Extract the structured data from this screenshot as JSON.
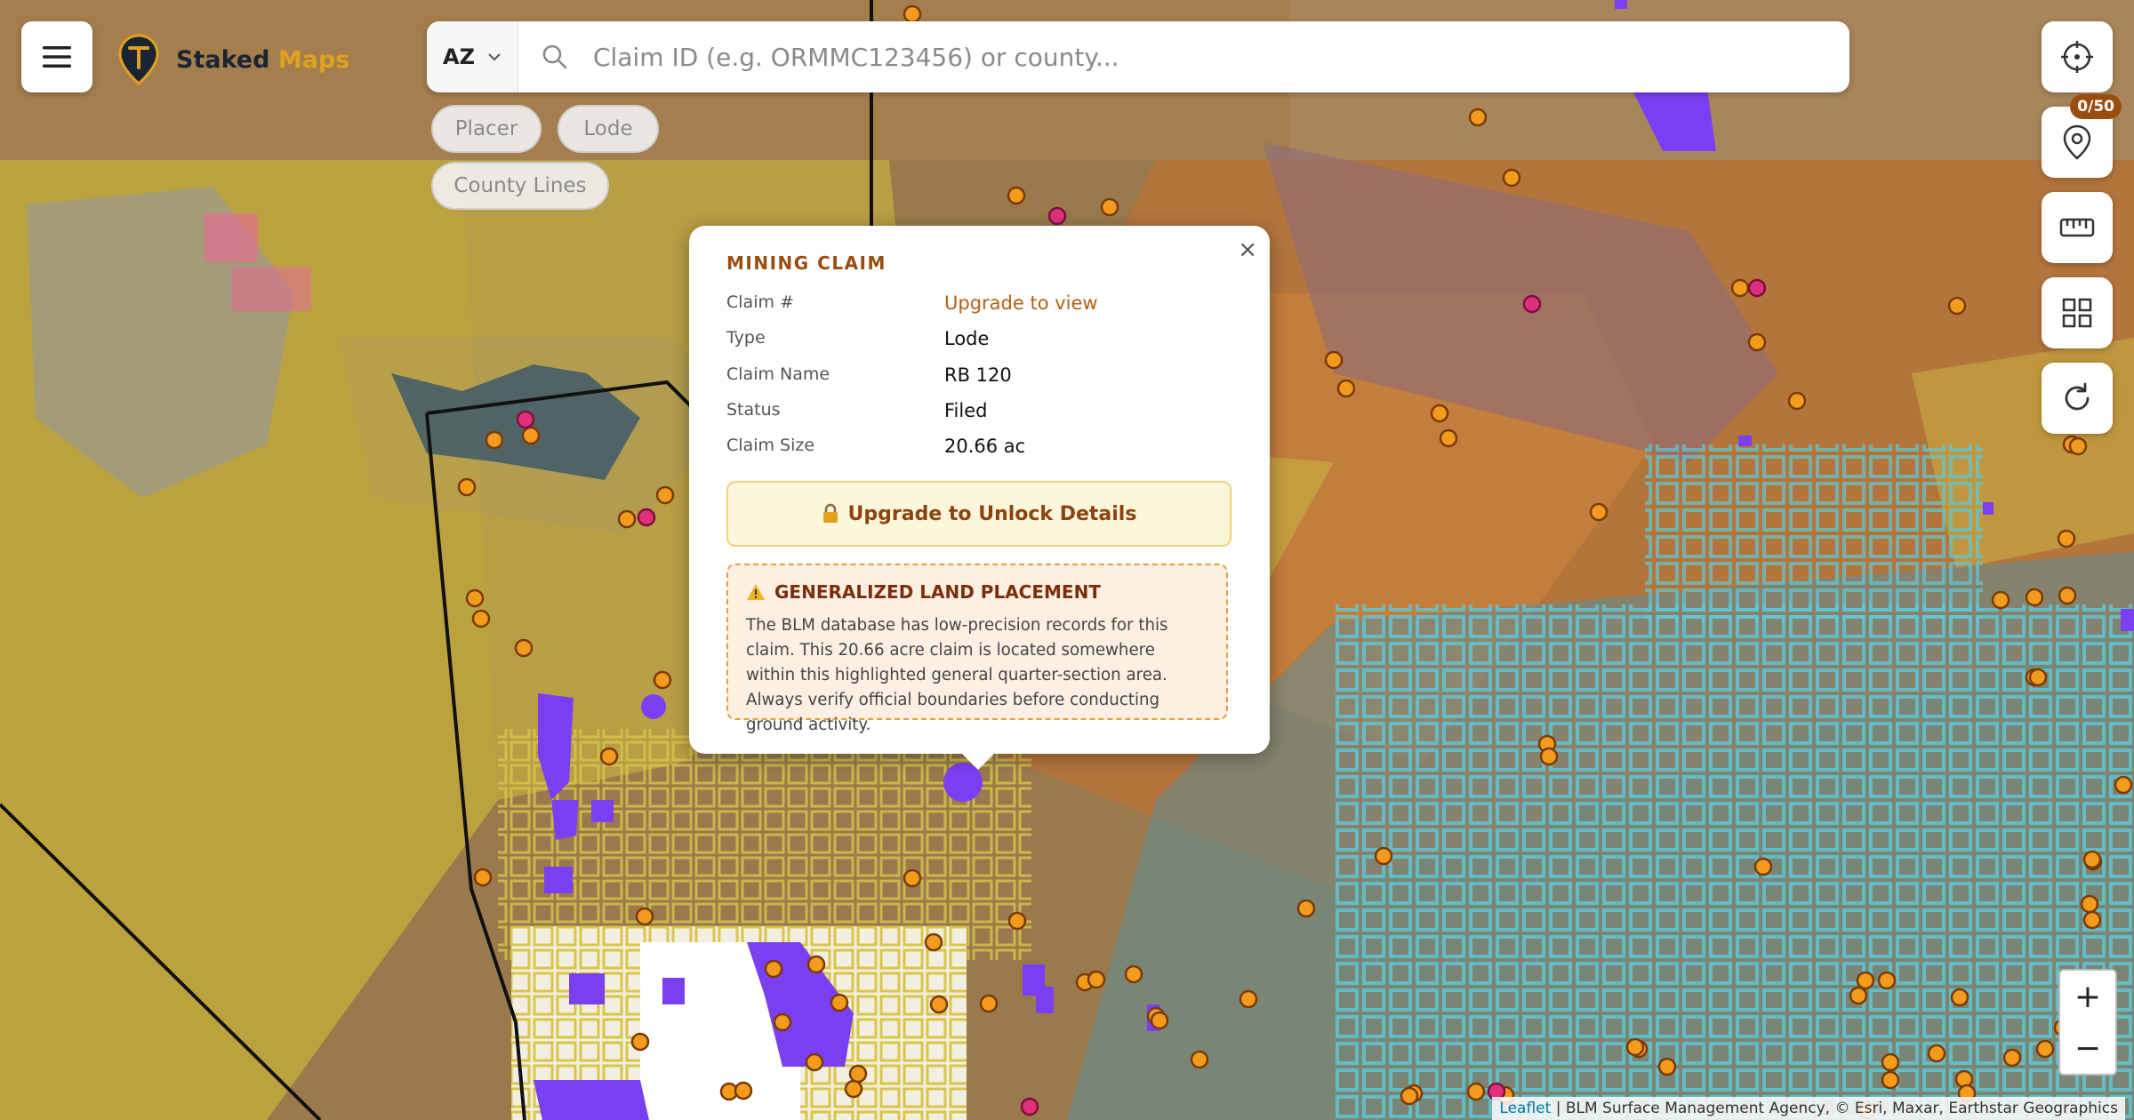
{
  "app": {
    "brand_part1": "Staked",
    "brand_part2": "Maps"
  },
  "search": {
    "state": "AZ",
    "placeholder": "Claim ID (e.g. ORMMC123456) or county..."
  },
  "filters": [
    "Placer",
    "Lode",
    "County Lines"
  ],
  "toolbar": {
    "locate_icon": "crosshair-icon",
    "saved_icon": "map-pin-icon",
    "saved_count": "0/50",
    "measure_icon": "ruler-icon",
    "layers_icon": "grid-icon",
    "refresh_icon": "refresh-icon"
  },
  "popup": {
    "title": "MINING CLAIM",
    "close": "×",
    "rows": [
      {
        "label": "Claim #",
        "value": "Upgrade to view"
      },
      {
        "label": "Type",
        "value": "Lode"
      },
      {
        "label": "Claim Name",
        "value": "RB 120"
      },
      {
        "label": "Status",
        "value": "Filed"
      },
      {
        "label": "Claim Size",
        "value": "20.66 ac"
      }
    ],
    "unlock_label": "Upgrade to Unlock Details",
    "warning_title": "GENERALIZED LAND PLACEMENT",
    "warning_text": "The BLM database has low-precision records for this claim. This 20.66 acre claim is located somewhere within this highlighted general quarter-section area. Always verify official boundaries before conducting ground activity."
  },
  "zoom": {
    "in": "+",
    "out": "−"
  },
  "attribution": {
    "leaflet": "Leaflet",
    "rest": " | BLM Surface Management Agency, © Esri, Maxar, Earthstar Geographics"
  },
  "colors": {
    "accent": "#9b4d0f",
    "gold": "#e0a020",
    "blm_land": "#d4c23a",
    "state_land": "#4fc3d6",
    "claim_point": "#f29b1d",
    "claim_lode": "#7b3ff2"
  }
}
